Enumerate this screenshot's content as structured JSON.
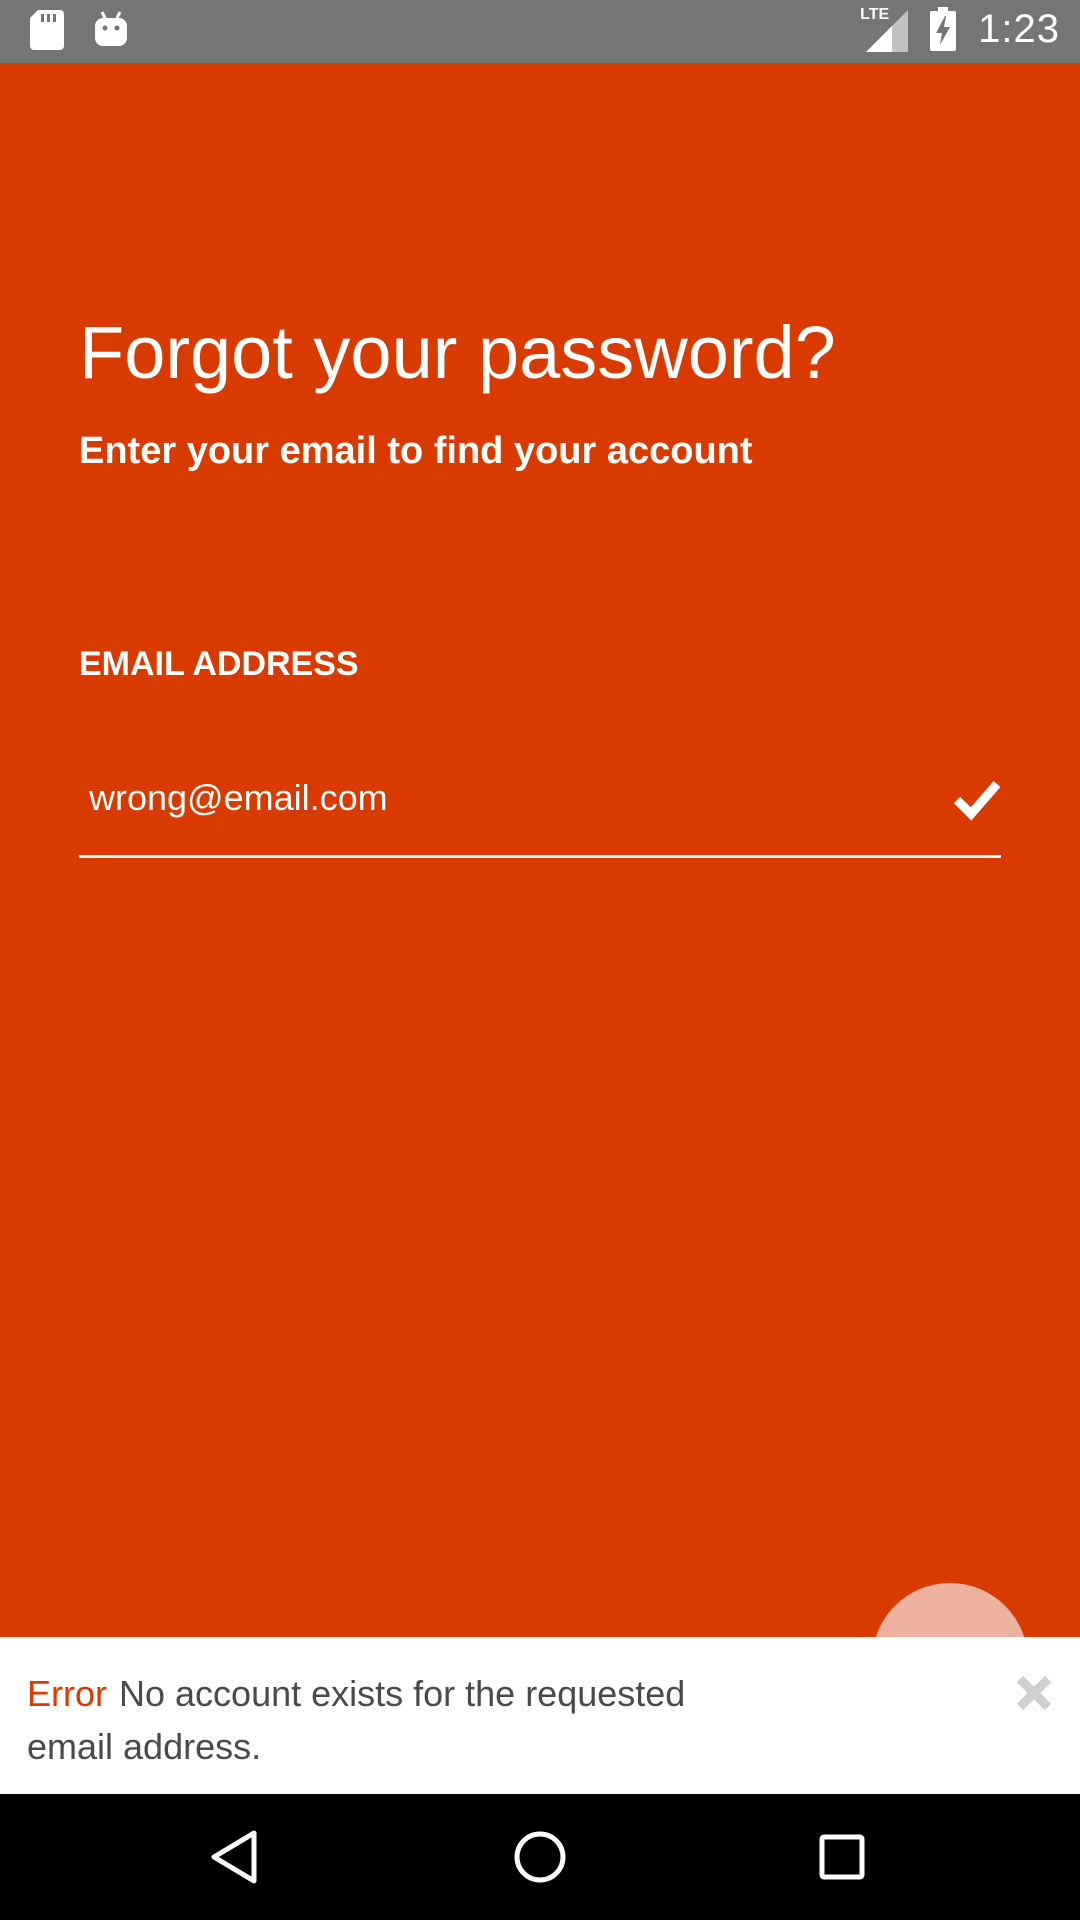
{
  "status_bar": {
    "time": "1:23",
    "network": "LTE",
    "icons": [
      "sd-card-icon",
      "android-icon",
      "signal-icon",
      "battery-charging-icon"
    ]
  },
  "page": {
    "title": "Forgot your password?",
    "subtitle": "Enter your email to find your account"
  },
  "form": {
    "email_label": "EMAIL ADDRESS",
    "email_value": "wrong@email.com",
    "valid_icon": "check-icon"
  },
  "snackbar": {
    "error_label": "Error",
    "message": "No account exists for the requested email address.",
    "close_icon": "close-icon"
  },
  "nav_bar": {
    "buttons": [
      "back-icon",
      "home-icon",
      "recents-icon"
    ]
  },
  "colors": {
    "background": "#D93A00",
    "status_bar": "#757575",
    "fab": "#EFB19F",
    "error_text": "#D93A00",
    "snackbar_bg": "#FFFFFF"
  }
}
